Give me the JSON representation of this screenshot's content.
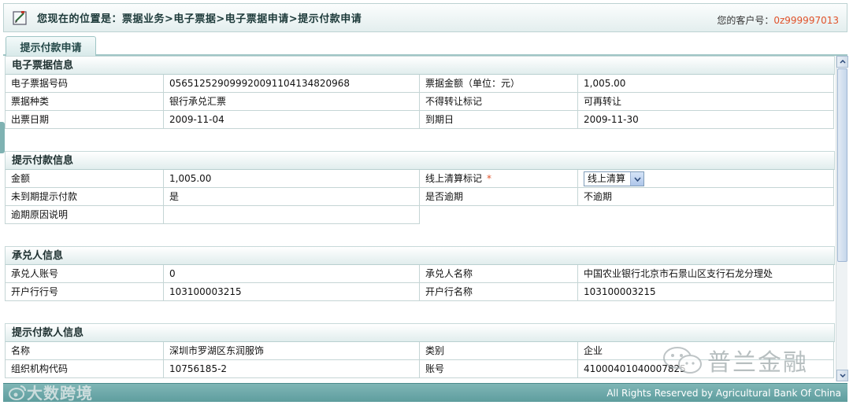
{
  "breadcrumb": {
    "prefix": "您现在的位置是：",
    "path": "票据业务>电子票据>电子票据申请>提示付款申请"
  },
  "customer": {
    "label": "您的客户号：",
    "number": "0z999997013"
  },
  "tab": {
    "label": "提示付款申请"
  },
  "bill_info": {
    "title": "电子票据信息",
    "rows": [
      [
        "电子票据号码",
        "0565125290999200911041348209​68",
        "票据金额（单位：元）",
        "1,005.00"
      ],
      [
        "票据种类",
        "银行承兑汇票",
        "不得转让标记",
        "可再转让"
      ],
      [
        "出票日期",
        "2009-11-04",
        "到期日",
        "2009-11-30"
      ]
    ]
  },
  "payment_info": {
    "title": "提示付款信息",
    "amount_label": "金额",
    "amount_value": "1,005.00",
    "online_label": "线上清算标记",
    "required_mark": "*",
    "online_select_value": "线上清算",
    "early_label": "未到期提示付款",
    "early_value": "是",
    "overdue_label": "是否逾期",
    "overdue_value": "不逾期",
    "overdue_reason_label": "逾期原因说明",
    "overdue_reason_value": ""
  },
  "acceptor_info": {
    "title": "承兑人信息",
    "rows": [
      [
        "承兑人账号",
        "0",
        "承兑人名称",
        "中国农业银行北京市石景山区支行石龙分理处"
      ],
      [
        "开户行行号",
        "103100003215",
        "开户行名称",
        "103100003215"
      ]
    ]
  },
  "presenter_info": {
    "title": "提示付款人信息",
    "rows": [
      [
        "名称",
        "深圳市罗湖区东润服饰",
        "类别",
        "企业"
      ],
      [
        "组织机构代码",
        "10756185-2",
        "账号",
        "41000401040007825"
      ]
    ]
  },
  "footer": {
    "copyright": "All Rights Reserved by Agricultural Bank Of China"
  },
  "watermarks": {
    "right": "普兰金融",
    "left": "大数跨境"
  },
  "colors": {
    "accent_orange": "#e0522a",
    "footer_teal": "#6aa7a8",
    "border": "#c5d5d5"
  },
  "icons": [
    "edit-location-icon",
    "select-arrow-icon",
    "scroll-up-icon",
    "scroll-down-icon",
    "wechat-icon",
    "weibo-icon"
  ]
}
